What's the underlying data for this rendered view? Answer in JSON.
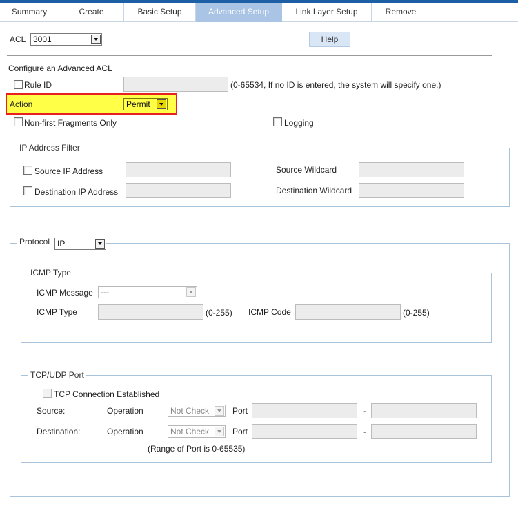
{
  "tabs": [
    {
      "label": "Summary",
      "active": false
    },
    {
      "label": "Create",
      "active": false
    },
    {
      "label": "Basic Setup",
      "active": false
    },
    {
      "label": "Advanced Setup",
      "active": true
    },
    {
      "label": "Link Layer Setup",
      "active": false
    },
    {
      "label": "Remove",
      "active": false
    }
  ],
  "acl": {
    "label": "ACL",
    "value": "3001"
  },
  "help_label": "Help",
  "section_title": "Configure an Advanced ACL",
  "rule_id": {
    "label": "Rule ID",
    "value": "",
    "hint": "(0-65534, If no ID is entered, the system will specify one.)"
  },
  "action": {
    "label": "Action",
    "value": "Permit",
    "highlight_color": "#ffff48",
    "border_color": "#e82020"
  },
  "non_first_fragments_label": "Non-first Fragments Only",
  "logging_label": "Logging",
  "ip_filter": {
    "legend": "IP Address Filter",
    "source_ip_label": "Source IP Address",
    "source_wildcard_label": "Source Wildcard",
    "dest_ip_label": "Destination IP Address",
    "dest_wildcard_label": "Destination Wildcard"
  },
  "protocol": {
    "label": "Protocol",
    "value": "IP"
  },
  "icmp": {
    "legend": "ICMP Type",
    "message_label": "ICMP Message",
    "message_value": "---",
    "type_label": "ICMP Type",
    "type_range": "(0-255)",
    "code_label": "ICMP Code",
    "code_range": "(0-255)"
  },
  "tcpudp": {
    "legend": "TCP/UDP Port",
    "established_label": "TCP Connection Established",
    "source_label": "Source:",
    "destination_label": "Destination:",
    "operation_label": "Operation",
    "port_label": "Port",
    "dash": "-",
    "source_operation": "Not Check",
    "dest_operation": "Not Check",
    "range_note": "(Range of Port is 0-65535)"
  },
  "colors": {
    "accent": "#1d5fa5",
    "active_tab": "#a9c4e4",
    "fieldset_border": "#a9c3da"
  }
}
